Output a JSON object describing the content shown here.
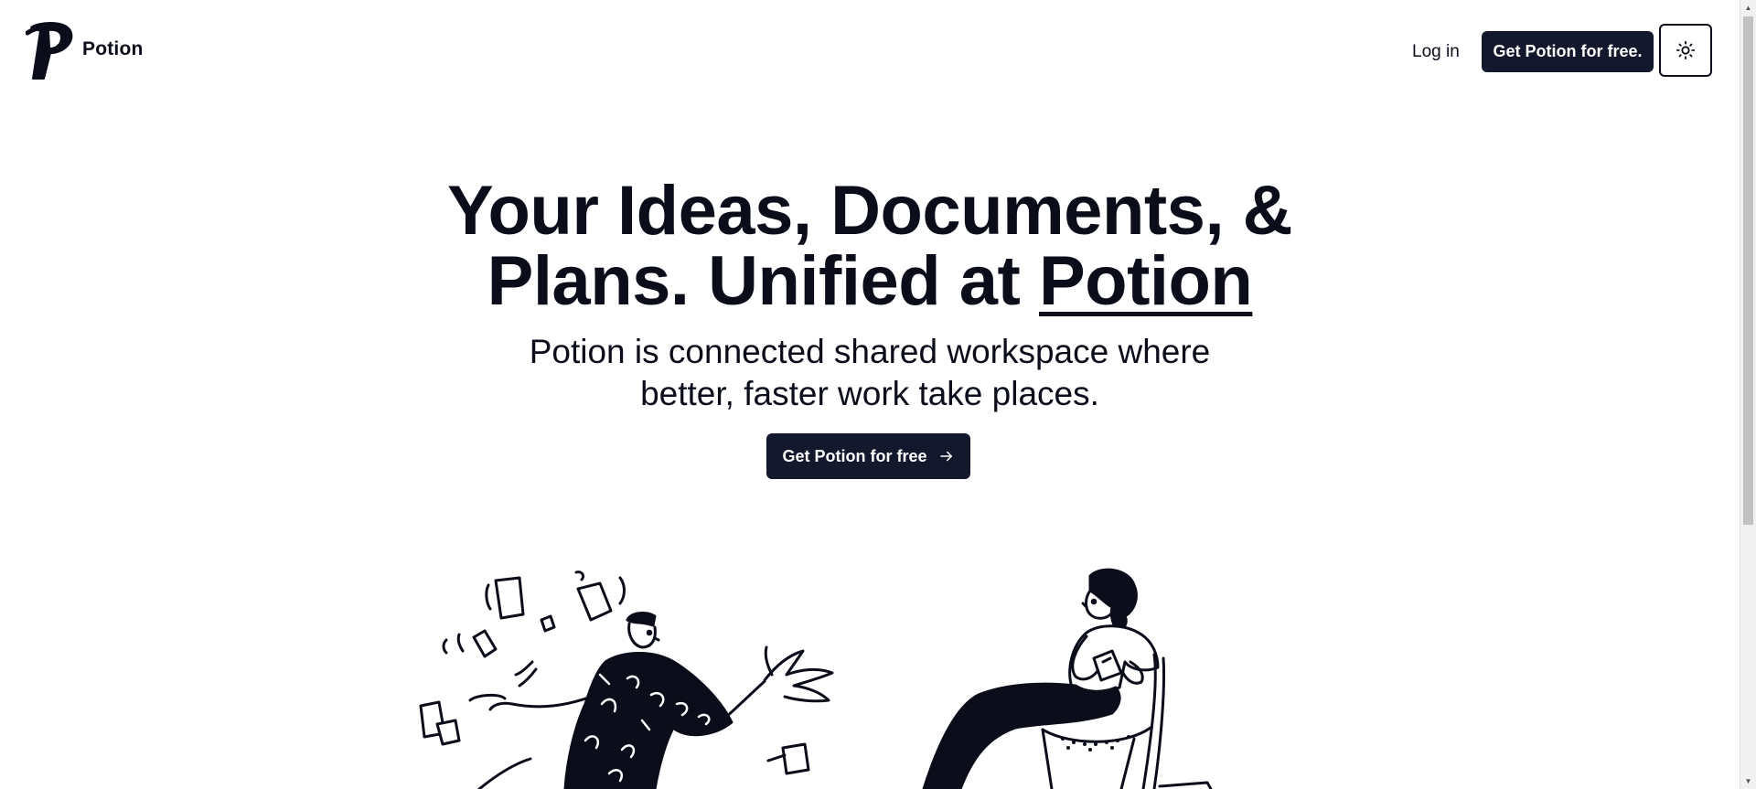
{
  "header": {
    "brand_name": "Potion",
    "login_label": "Log in",
    "cta_label": "Get Potion for free.",
    "theme_toggle_icon": "sun-icon"
  },
  "hero": {
    "title_line1": "Your Ideas, Documents, &",
    "title_line2_prefix": "Plans. Unified at ",
    "title_brand": "Potion",
    "subtitle_line1": "Potion is connected shared workspace where",
    "subtitle_line2": "better, faster work take places.",
    "cta_label": "Get Potion for free",
    "cta_icon": "arrow-right-icon"
  },
  "illustrations": {
    "left": "person-juggling-documents-illustration",
    "right": "person-reading-in-chair-illustration"
  },
  "colors": {
    "primary_button": "#13182c",
    "text": "#0b0d1a",
    "background": "#ffffff"
  }
}
